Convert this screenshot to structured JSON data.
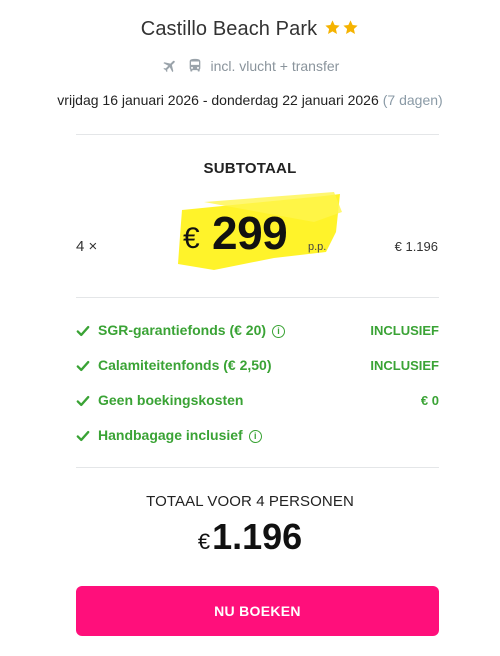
{
  "hotel": {
    "name": "Castillo Beach Park",
    "stars": 2,
    "star_color": "#f5b301"
  },
  "transport": {
    "icons": [
      "plane-icon",
      "bus-icon"
    ],
    "text": "incl. vlucht + transfer"
  },
  "dates": {
    "range": "vrijdag 16 januari 2026 - donderdag 22 januari 2026",
    "duration": "(7 dagen)"
  },
  "subtotal": {
    "label": "SUBTOTAAL",
    "quantity": "4 ×",
    "currency": "€",
    "price_per_person": "299",
    "per_person_label": "p.p.",
    "row_total": "€ 1.196",
    "highlight_color": "#fff21f"
  },
  "inclusions": [
    {
      "label": "SGR-garantiefonds (€ 20)",
      "info": true,
      "value": "INCLUSIEF"
    },
    {
      "label": "Calamiteitenfonds (€ 2,50)",
      "info": false,
      "value": "INCLUSIEF"
    },
    {
      "label": "Geen boekingskosten",
      "info": false,
      "value": "€ 0"
    },
    {
      "label": "Handbagage inclusief",
      "info": true,
      "value": ""
    }
  ],
  "inclusion_color": "#3aa335",
  "total": {
    "label": "TOTAAL VOOR 4 PERSONEN",
    "currency": "€",
    "amount": "1.196"
  },
  "book_button": {
    "label": "NU BOEKEN",
    "color": "#ff0f7b"
  }
}
